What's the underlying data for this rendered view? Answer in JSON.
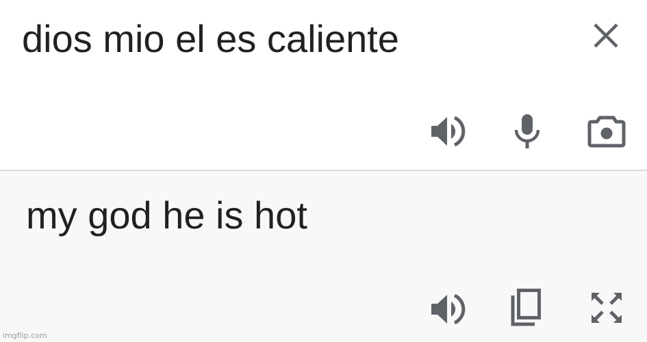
{
  "source": {
    "text": "dios mio el es caliente",
    "icons": {
      "clear": "close-icon",
      "listen": "speaker-icon",
      "voice": "microphone-icon",
      "camera": "camera-icon"
    }
  },
  "translation": {
    "text": "my god he is hot",
    "icons": {
      "listen": "speaker-icon",
      "copy": "copy-icon",
      "fullscreen": "fullscreen-icon"
    }
  },
  "watermark": "imgflip.com",
  "colors": {
    "text": "#202124",
    "icon": "#5f6368",
    "source_bg": "#ffffff",
    "target_bg": "#f8f8f8",
    "divider": "#d8d8d8"
  }
}
